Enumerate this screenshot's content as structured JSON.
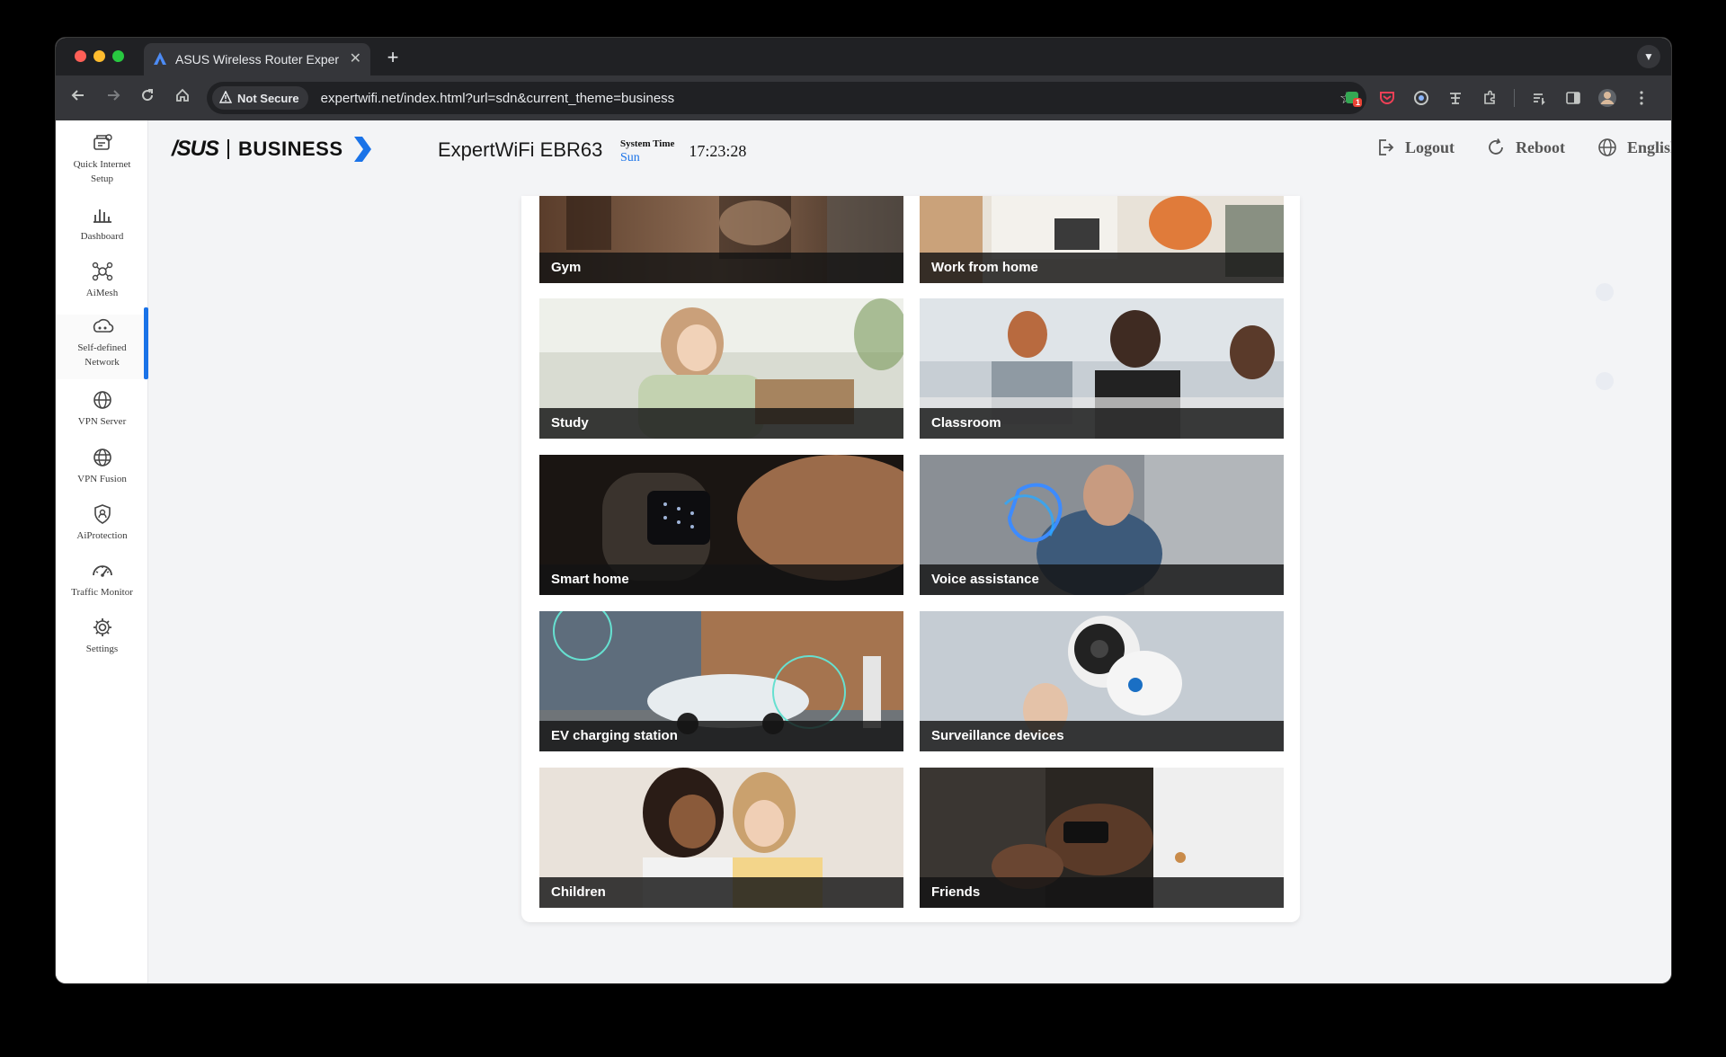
{
  "browser": {
    "tab_title": "ASUS Wireless Router Exper",
    "security_label": "Not Secure",
    "url": "expertwifi.net/index.html?url=sdn&current_theme=business",
    "ext_badge": "1"
  },
  "brand": {
    "logo_text": "/SUS",
    "business": "BUSINESS",
    "model": "ExpertWiFi EBR63"
  },
  "system_time": {
    "label": "System Time",
    "day": "Sun",
    "clock": "17:23:28"
  },
  "header_actions": {
    "logout": "Logout",
    "reboot": "Reboot",
    "language": "English"
  },
  "sidebar": {
    "items": [
      {
        "label": "Quick Internet Setup",
        "icon": "quick-setup-icon"
      },
      {
        "label": "Dashboard",
        "icon": "dashboard-icon"
      },
      {
        "label": "AiMesh",
        "icon": "aimesh-icon"
      },
      {
        "label": "Self-defined Network",
        "icon": "sdn-icon"
      },
      {
        "label": "VPN Server",
        "icon": "vpn-server-icon"
      },
      {
        "label": "VPN Fusion",
        "icon": "vpn-fusion-icon"
      },
      {
        "label": "AiProtection",
        "icon": "aiprotection-icon"
      },
      {
        "label": "Traffic Monitor",
        "icon": "traffic-monitor-icon"
      },
      {
        "label": "Settings",
        "icon": "settings-icon"
      }
    ],
    "active_index": 3
  },
  "scenarios": [
    {
      "label": "Gym"
    },
    {
      "label": "Work from home"
    },
    {
      "label": "Study"
    },
    {
      "label": "Classroom"
    },
    {
      "label": "Smart home"
    },
    {
      "label": "Voice assistance"
    },
    {
      "label": "EV charging station"
    },
    {
      "label": "Surveillance devices"
    },
    {
      "label": "Children"
    },
    {
      "label": "Friends"
    }
  ],
  "colors": {
    "accent": "#1a73e8",
    "caption_bg": "#141414",
    "chrome_dark": "#202124"
  }
}
